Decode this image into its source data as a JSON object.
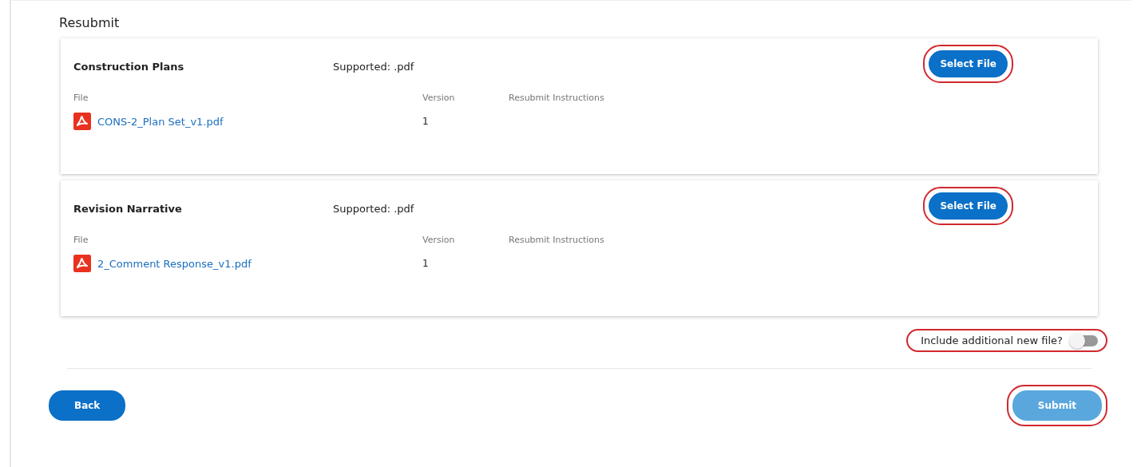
{
  "title": "Resubmit",
  "documents": [
    {
      "name": "Construction Plans",
      "supported": "Supported: .pdf",
      "button": {
        "label": "Select File",
        "highlighted": true
      },
      "columns": [
        "File",
        "Version",
        "Resubmit Instructions"
      ],
      "file": "CONS-2_Plan Set_v1.pdf",
      "version": "1"
    },
    {
      "name": "Revision Narrative",
      "supported": "Supported: .pdf",
      "button": {
        "label": "Select File",
        "highlighted": true
      },
      "columns": [
        "File",
        "Version",
        "Resubmit Instructions"
      ],
      "file": "2_Comment Response_v1.pdf",
      "version": "1"
    }
  ],
  "additional_file": {
    "label": "Include additional new file?",
    "on": false,
    "highlighted": true
  },
  "back_button": {
    "label": "Back",
    "disabled": false,
    "highlighted": false
  },
  "submit_button": {
    "label": "Submit",
    "disabled": true,
    "highlighted": true
  }
}
